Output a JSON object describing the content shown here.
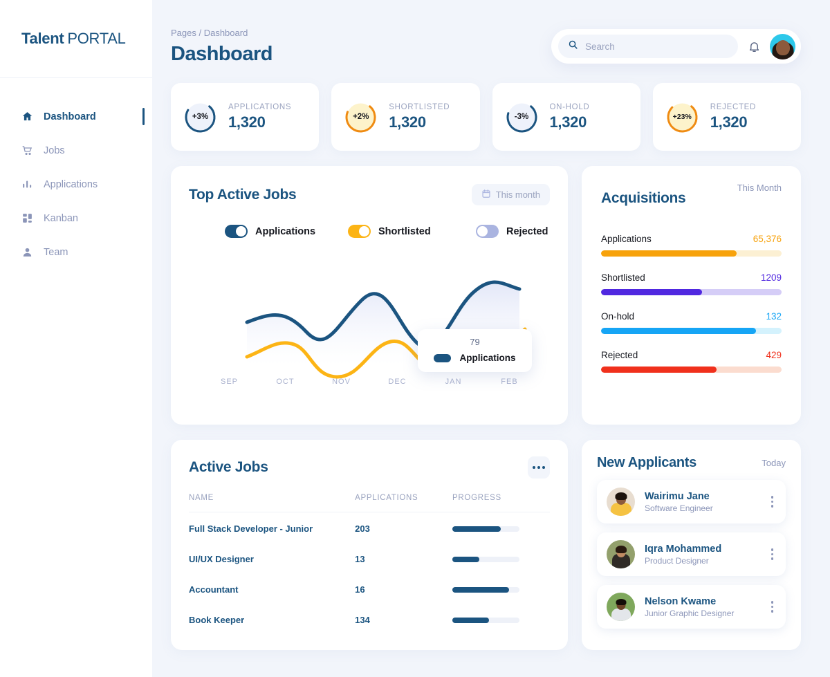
{
  "brand": {
    "part1": "Talent",
    "part2": "PORTAL"
  },
  "sidebar": {
    "items": [
      {
        "label": "Dashboard",
        "icon": "home-icon",
        "active": true
      },
      {
        "label": "Jobs",
        "icon": "cart-icon",
        "active": false
      },
      {
        "label": "Applications",
        "icon": "bars-icon",
        "active": false
      },
      {
        "label": "Kanban",
        "icon": "kanban-icon",
        "active": false
      },
      {
        "label": "Team",
        "icon": "person-icon",
        "active": false
      }
    ]
  },
  "header": {
    "breadcrumb": "Pages / Dashboard",
    "title": "Dashboard",
    "search_placeholder": "Search",
    "search_value": ""
  },
  "stats": [
    {
      "label": "APPLICATIONS",
      "value": "1,320",
      "delta": "+3%",
      "arc_color": "#1b5480",
      "fill_color": "#eef2fb",
      "text_color": "#16181f",
      "pct": 72
    },
    {
      "label": "SHORTLISTED",
      "value": "1,320",
      "delta": "+2%",
      "arc_color": "#ef8b12",
      "fill_color": "#fdf3cb",
      "text_color": "#16181f",
      "pct": 70
    },
    {
      "label": "ON-HOLD",
      "value": "1,320",
      "delta": "-3%",
      "arc_color": "#1b5480",
      "fill_color": "#eef2fb",
      "text_color": "#16181f",
      "pct": 68
    },
    {
      "label": "REJECTED",
      "value": "1,320",
      "delta": "+23%",
      "arc_color": "#ef8b12",
      "fill_color": "#fdf3cb",
      "text_color": "#16181f",
      "pct": 76
    }
  ],
  "top_active_jobs": {
    "title": "Top Active Jobs",
    "period_label": "This month",
    "legend": [
      {
        "label": "Applications",
        "color": "#1b5480",
        "on": true
      },
      {
        "label": "Shortlisted",
        "color": "#fcb415",
        "on": true
      },
      {
        "label": "Rejected",
        "color": "#aab4e0",
        "on": false
      }
    ],
    "tooltip": {
      "value": "79",
      "label": "Applications"
    }
  },
  "chart_data": {
    "type": "line",
    "title": "Top Active Jobs",
    "xlabel": "",
    "ylabel": "",
    "grid": false,
    "legend_position": "top",
    "categories": [
      "SEP",
      "OCT",
      "NOV",
      "DEC",
      "JAN",
      "FEB"
    ],
    "ylim": [
      0,
      100
    ],
    "series": [
      {
        "name": "Applications",
        "color": "#1b5480",
        "values": [
          52,
          57,
          38,
          64,
          30,
          79
        ]
      },
      {
        "name": "Shortlisted",
        "color": "#fcb415",
        "values": [
          25,
          35,
          8,
          32,
          10,
          27
        ]
      },
      {
        "name": "Rejected",
        "color": "#aab4e0",
        "values": [],
        "hidden": true
      }
    ],
    "annotation": {
      "x": "FEB",
      "series": "Applications",
      "value": 79
    }
  },
  "acquisitions": {
    "title": "Acquisitions",
    "period_label": "This Month",
    "rows": [
      {
        "label": "Applications",
        "value": "65,376",
        "pct": 75,
        "color": "#f7a20b",
        "track": "#fcf0d3"
      },
      {
        "label": "Shortlisted",
        "value": "1209",
        "pct": 56,
        "color": "#5028e0",
        "track": "#d5cdf7"
      },
      {
        "label": "On-hold",
        "value": "132",
        "pct": 86,
        "color": "#16a5f5",
        "track": "#d4f2fd"
      },
      {
        "label": "Rejected",
        "value": "429",
        "pct": 64,
        "color": "#f0301c",
        "track": "#fbdccf"
      }
    ]
  },
  "active_jobs": {
    "title": "Active Jobs",
    "columns": [
      "NAME",
      "APPLICATIONS",
      "PROGRESS"
    ],
    "rows": [
      {
        "name": "Full Stack Developer - Junior",
        "applications": "203",
        "progress": 72
      },
      {
        "name": "UI/UX Designer",
        "applications": "13",
        "progress": 40
      },
      {
        "name": "Accountant",
        "applications": "16",
        "progress": 85
      },
      {
        "name": "Book Keeper",
        "applications": "134",
        "progress": 55
      }
    ]
  },
  "new_applicants": {
    "title": "New Applicants",
    "period_label": "Today",
    "items": [
      {
        "name": "Wairimu Jane",
        "role": "Software Engineer",
        "skin": "#8c5a3c",
        "hair": "#1c120c",
        "shirt": "#f5c242",
        "bg": "#e8ddd0"
      },
      {
        "name": "Iqra Mohammed",
        "role": "Product Designer",
        "skin": "#c08b63",
        "hair": "#2a1a10",
        "shirt": "#2f2a26",
        "bg": "#93a06c"
      },
      {
        "name": "Nelson Kwame",
        "role": "Junior Graphic Designer",
        "skin": "#6b4226",
        "hair": "#140d08",
        "shirt": "#e3e6ea",
        "bg": "#7fa85c"
      }
    ]
  }
}
